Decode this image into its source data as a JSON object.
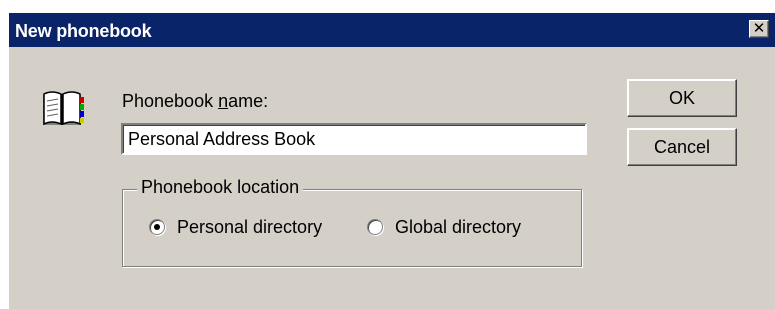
{
  "window": {
    "title": "New phonebook",
    "close_glyph": "✕"
  },
  "form": {
    "name_label_pre": "Phonebook ",
    "name_label_underlined": "n",
    "name_label_post": "ame:",
    "name_value": "Personal Address Book",
    "location_group_label": "Phonebook location",
    "options": [
      {
        "label": "Personal directory",
        "selected": true
      },
      {
        "label": "Global directory",
        "selected": false
      }
    ]
  },
  "buttons": {
    "ok_label": "OK",
    "cancel_label": "Cancel"
  },
  "icons": {
    "dialog_icon": "phonebook-icon"
  },
  "colors": {
    "title_bar": "#0a246a",
    "dialog_face": "#d4d0c8"
  }
}
